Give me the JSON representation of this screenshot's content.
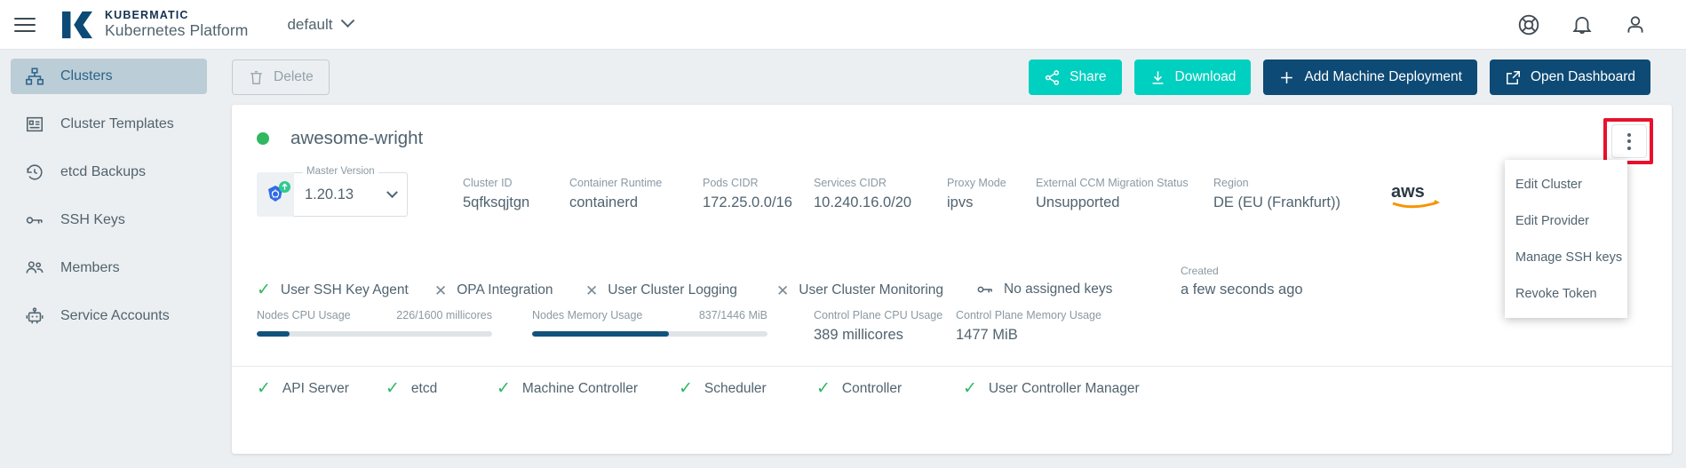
{
  "topbar": {
    "menu_icon": "hamburger-icon",
    "brand_line1": "KUBERMATIC",
    "brand_line2": "Kubernetes Platform",
    "project": "default",
    "icons": [
      "help-icon",
      "notifications-bell-icon",
      "account-person-icon"
    ]
  },
  "sidebar": {
    "items": [
      {
        "label": "Clusters",
        "icon": "clusters-icon",
        "active": true
      },
      {
        "label": "Cluster Templates",
        "icon": "cluster-templates-icon",
        "active": false
      },
      {
        "label": "etcd Backups",
        "icon": "history-restore-icon",
        "active": false
      },
      {
        "label": "SSH Keys",
        "icon": "key-icon",
        "active": false
      },
      {
        "label": "Members",
        "icon": "members-icon",
        "active": false
      },
      {
        "label": "Service Accounts",
        "icon": "service-account-robot-icon",
        "active": false
      }
    ]
  },
  "toolbar": {
    "delete_label": "Delete",
    "share_label": "Share",
    "download_label": "Download",
    "add_machine_deployment_label": "Add Machine Deployment",
    "open_dashboard_label": "Open Dashboard"
  },
  "cluster": {
    "name": "awesome-wright",
    "status_color": "#30b860",
    "master_version_label": "Master Version",
    "master_version_value": "1.20.13",
    "provider_logo": "aws-logo",
    "meta": [
      {
        "key": "Cluster ID",
        "value": "5qfksqjtgn"
      },
      {
        "key": "Container Runtime",
        "value": "containerd"
      },
      {
        "key": "Pods CIDR",
        "value": "172.25.0.0/16"
      },
      {
        "key": "Services CIDR",
        "value": "10.240.16.0/20"
      },
      {
        "key": "Proxy Mode",
        "value": "ipvs"
      },
      {
        "key": "External CCM Migration Status",
        "value": "Unsupported"
      },
      {
        "key": "Region",
        "value": "DE (EU (Frankfurt))"
      }
    ],
    "features": [
      {
        "label": "User SSH Key Agent",
        "state": "check"
      },
      {
        "label": "OPA Integration",
        "state": "cross"
      },
      {
        "label": "User Cluster Logging",
        "state": "cross"
      },
      {
        "label": "User Cluster Monitoring",
        "state": "cross"
      },
      {
        "label": "No assigned keys",
        "state": "key"
      }
    ],
    "created_key": "Created",
    "created_value": "a few seconds ago",
    "metrics": [
      {
        "key": "Nodes CPU Usage",
        "value": "226/1600 millicores",
        "percent": 14
      },
      {
        "key": "Nodes Memory Usage",
        "value": "837/1446 MiB",
        "percent": 58
      }
    ],
    "metrics_simple": [
      {
        "key": "Control Plane CPU Usage",
        "value": "389 millicores"
      },
      {
        "key": "Control Plane Memory Usage",
        "value": "1477 MiB"
      }
    ],
    "health": [
      {
        "label": "API Server",
        "state": "check"
      },
      {
        "label": "etcd",
        "state": "check"
      },
      {
        "label": "Machine Controller",
        "state": "check"
      },
      {
        "label": "Scheduler",
        "state": "check"
      },
      {
        "label": "Controller",
        "state": "check"
      },
      {
        "label": "User Controller Manager",
        "state": "check"
      }
    ]
  },
  "kebab_menu": {
    "items": [
      "Edit Cluster",
      "Edit Provider",
      "Manage SSH keys",
      "Revoke Token"
    ]
  },
  "annotation": {
    "highlight_color": "#e8112d"
  }
}
